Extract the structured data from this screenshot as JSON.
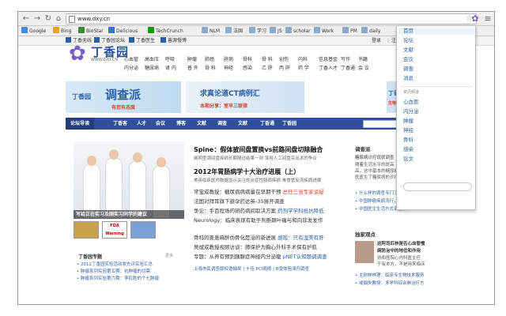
{
  "browser": {
    "url": "www.dxy.cn",
    "bookmarks": [
      {
        "label": "Google",
        "color": "#4a85e8"
      },
      {
        "label": "Bing",
        "color": "#e8a12a"
      },
      {
        "label": "BioStar",
        "color": "#3a8a3a"
      },
      {
        "label": "Delicious",
        "color": "#3274d2"
      },
      {
        "label": "TechCrunch",
        "color": "#0a9e01"
      },
      {
        "label": "NLM",
        "color": "#8fa8cc"
      },
      {
        "label": "法国",
        "color": "#8fa8cc"
      },
      {
        "label": "学习",
        "color": "#8fa8cc"
      },
      {
        "label": "JS",
        "color": "#8fa8cc"
      },
      {
        "label": "scholar",
        "color": "#8fa8cc"
      },
      {
        "label": "Work",
        "color": "#8fa8cc"
      },
      {
        "label": "PM",
        "color": "#8fa8cc"
      },
      {
        "label": "daily",
        "color": "#8fa8cc"
      }
    ]
  },
  "site_topbar": {
    "links": [
      "丁香无线",
      "丁香园论坛",
      "丁香医生",
      "善源慢博"
    ],
    "login": "登录",
    "register": "注册"
  },
  "logo": {
    "name": "丁香园",
    "url": "WWW.DXY.CN"
  },
  "top_nav": {
    "col1": [
      "心血管",
      "内分泌"
    ],
    "col2": [
      "高血压",
      "糖尿病"
    ],
    "col3": [
      "呼吸",
      "肾 内"
    ],
    "col4": [
      "肿瘤",
      "普 外"
    ],
    "col5": [
      "肺癌",
      "骨 科"
    ],
    "col6": [
      "肝病",
      "神经"
    ],
    "col7": [
      "骨科",
      "感染"
    ],
    "col8": [
      "骨 科",
      "乙 肝"
    ],
    "col9": [
      "创伤",
      "丙 肝"
    ],
    "col10": [
      "内科",
      "药 学"
    ],
    "col11": [
      "信息基金",
      "丁香人才"
    ],
    "col12": [
      "写作",
      "丁香通"
    ],
    "col13": [
      "书籍",
      "会 议"
    ]
  },
  "banners": {
    "left_brand": "丁香园",
    "left_title": "调查派",
    "left_sub": "有您有态度",
    "mid_title": "求真论道CT病例汇",
    "mid_sub": "本期分享：室早三联律",
    "right_title": "丁香园",
    "right_sub": "生物行业研究"
  },
  "main_nav": [
    "论坛导读",
    "丁香客",
    "人才",
    "会议",
    "博客",
    "文献",
    "调查",
    "文献",
    "丁香通",
    "丁香园"
  ],
  "feature": {
    "caption": "写给正在实习及刚实习同学的建议",
    "thumbs": [
      "",
      "FDA Warning",
      ""
    ]
  },
  "headlines": [
    {
      "title": "Spine：假体披间盘置换vs前路间盘切除融合",
      "sub": "阐明型颈间盘疾病长期随访结果一则  误用人工间盘突出术的争议"
    },
    {
      "title": "2012年胃肠病学十大治疗进展（上）",
      "sub": "美英临床医师数据显示关注的炎症性肠病疾病  胃食管反流疾病进展"
    }
  ],
  "news": [
    {
      "text": "常宝成教授：糖尿病病病量在早期干预",
      "extra": "总任三当专家谈疑"
    },
    {
      "text": "法国对拜耳旗下避孕药达英-35展开调查",
      "extra": ""
    },
    {
      "text": "争论：手百程场的研药病间取决方案",
      "extra": "药剂学学科抵抗降低"
    },
    {
      "text": "Neurology：临床表现有助于判断颞叶痛与和向非发发作",
      "extra": ""
    },
    {
      "text": "骨科的患患麻醉伪骨化是治的新进展",
      "extra": "感现：只有湿美有肝"
    },
    {
      "text": "吴斌成教授视频访谈：肺保护为胸心外科手术保有护航",
      "extra": ""
    },
    {
      "text": "专题：从养有预到胰腺症神经内分泌瘤",
      "extra": "pNET认知题调调查"
    }
  ],
  "footer_links": [
    "上海市民调查版权邀抽奖",
    "十佳 PCI病例",
    "B受体阻滞剂调查"
  ],
  "column": {
    "title": "丁香园专题",
    "more": "更多",
    "items": [
      "2012丁香园实验活动发先评实验汇总",
      "肿瘤系列实验第五期：抗肿瘤的切需",
      "肿瘤系列实验第六期：孪肛胜的个七肿瘤"
    ]
  },
  "right": {
    "survey_title": "调查派",
    "survey_items": [
      "糖尿病诊疗现状调查",
      "随着生活水平的提高",
      "高，这中基本的糖尿病",
      "医医生了糖尿病的诊疗"
    ],
    "survey_list": [
      "什么样的调查专门了调查",
      "中国肿瘤疾病流行，市面",
      "中国医生生活方式调查研"
    ],
    "expert_title": "独家观点",
    "expert_lines": [
      "这阿司匹林是否心血管慢",
      "病防治中的地位和作用",
      "协和医院心内科医主任",
      "于有本方，不是用来临床"
    ],
    "expert_list": [
      "主树林林理：临床专生物技术服务",
      "戒烟失教授：多学科综合肺治疗方"
    ]
  },
  "dropdown": {
    "items": [
      "首页",
      "论坛",
      "文献",
      "会议",
      "调查",
      "消息"
    ],
    "section": "资讯频道",
    "channels": [
      "心血管",
      "内分泌",
      "肿瘤",
      "神经",
      "骨科",
      "感染",
      "论文"
    ],
    "search_placeholder": ""
  }
}
